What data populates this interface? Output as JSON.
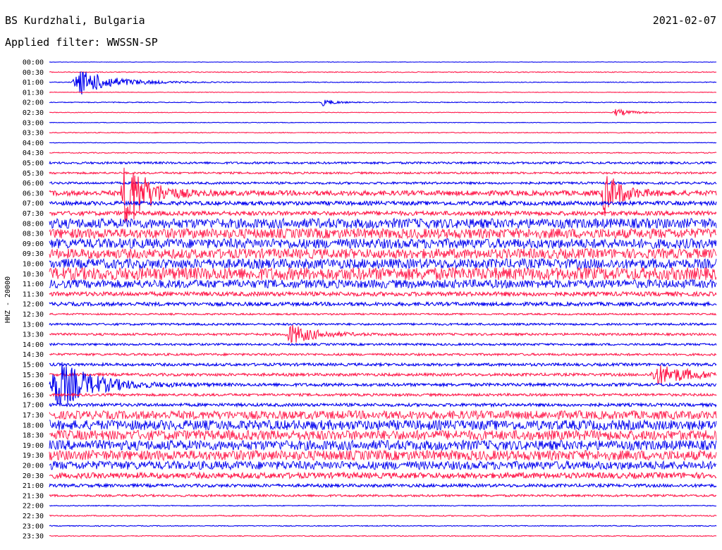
{
  "header": {
    "station": "BS Kurdzhali, Bulgaria",
    "date": "2021-02-07",
    "filter": "Applied filter: WWSSN-SP"
  },
  "chart_data": {
    "type": "line",
    "title": "BS Kurdzhali, Bulgaria",
    "subtitle": "Applied filter: WWSSN-SP",
    "ylabel": "HHZ - 20000",
    "row_interval_minutes": 30,
    "row_labels": [
      "00:00",
      "00:30",
      "01:00",
      "01:30",
      "02:00",
      "02:30",
      "03:00",
      "03:30",
      "04:00",
      "04:30",
      "05:00",
      "05:30",
      "06:00",
      "06:30",
      "07:00",
      "07:30",
      "08:00",
      "08:30",
      "09:00",
      "09:30",
      "10:00",
      "10:30",
      "11:00",
      "11:30",
      "12:00",
      "12:30",
      "13:00",
      "13:30",
      "14:00",
      "14:30",
      "15:00",
      "15:30",
      "16:00",
      "16:30",
      "17:00",
      "17:30",
      "18:00",
      "18:30",
      "19:00",
      "19:30",
      "20:00",
      "20:30",
      "21:00",
      "21:30",
      "22:00",
      "22:30",
      "23:00",
      "23:30"
    ],
    "colors": {
      "even_rows": "#0000ee",
      "odd_rows": "#ff1a4b"
    },
    "noise_level_by_row": [
      0.3,
      0.6,
      0.5,
      0.4,
      0.6,
      0.4,
      0.4,
      0.6,
      0.4,
      0.7,
      1.5,
      1.4,
      1.6,
      3.5,
      2.8,
      3.0,
      7,
      7,
      7,
      7,
      7,
      9,
      6,
      3,
      2.6,
      1.2,
      1.5,
      1.6,
      1.5,
      1.6,
      2.0,
      2.0,
      2.2,
      1.8,
      2.2,
      6,
      7,
      7,
      7,
      7,
      6,
      4,
      2.2,
      1.5,
      0.6,
      0.8,
      0.6,
      0.6
    ],
    "events": [
      {
        "row_label": "01:00",
        "start_minute": 1.0,
        "peak_amplitude": 18,
        "duration_minutes": 2.5
      },
      {
        "row_label": "02:00",
        "start_minute": 12.2,
        "peak_amplitude": 5,
        "duration_minutes": 0.8
      },
      {
        "row_label": "02:30",
        "start_minute": 25.3,
        "peak_amplitude": 5,
        "duration_minutes": 1.2
      },
      {
        "row_label": "06:30",
        "start_minute": 3.2,
        "peak_amplitude": 55,
        "duration_minutes": 1.5
      },
      {
        "row_label": "06:30",
        "start_minute": 24.8,
        "peak_amplitude": 30,
        "duration_minutes": 1.2
      },
      {
        "row_label": "13:30",
        "start_minute": 10.6,
        "peak_amplitude": 14,
        "duration_minutes": 1.8
      },
      {
        "row_label": "15:30",
        "start_minute": 27.0,
        "peak_amplitude": 14,
        "duration_minutes": 2.5
      },
      {
        "row_label": "16:00",
        "start_minute": 0.0,
        "peak_amplitude": 35,
        "duration_minutes": 2.5
      }
    ]
  }
}
